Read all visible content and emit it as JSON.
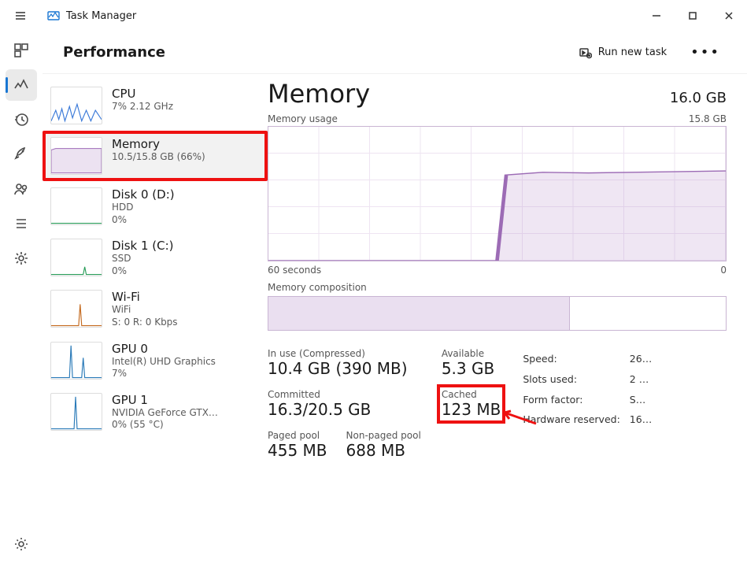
{
  "app": {
    "title": "Task Manager"
  },
  "header": {
    "page": "Performance",
    "run_new_task": "Run new task"
  },
  "rail": [
    {
      "name": "processes"
    },
    {
      "name": "performance",
      "active": true
    },
    {
      "name": "app-history"
    },
    {
      "name": "startup-apps"
    },
    {
      "name": "users"
    },
    {
      "name": "details"
    },
    {
      "name": "services"
    }
  ],
  "resources": [
    {
      "name": "CPU",
      "line1": "7%  2.12 GHz",
      "line2": ""
    },
    {
      "name": "Memory",
      "line1": "10.5/15.8 GB (66%)",
      "line2": "",
      "selected": true,
      "highlight": true
    },
    {
      "name": "Disk 0 (D:)",
      "line1": "HDD",
      "line2": "0%"
    },
    {
      "name": "Disk 1 (C:)",
      "line1": "SSD",
      "line2": "0%"
    },
    {
      "name": "Wi-Fi",
      "line1": "WiFi",
      "line2": "S: 0 R: 0 Kbps"
    },
    {
      "name": "GPU 0",
      "line1": "Intel(R) UHD Graphics",
      "line2": "7%"
    },
    {
      "name": "GPU 1",
      "line1": "NVIDIA GeForce GTX…",
      "line2": "0%  (55 °C)"
    }
  ],
  "detail": {
    "title": "Memory",
    "capacity": "16.0 GB",
    "usage_label": "Memory usage",
    "usage_cap": "15.8 GB",
    "axis_left": "60 seconds",
    "axis_right": "0",
    "composition_label": "Memory composition"
  },
  "stats": {
    "in_use_label": "In use (Compressed)",
    "in_use_value": "10.4 GB (390 MB)",
    "available_label": "Available",
    "available_value": "5.3 GB",
    "committed_label": "Committed",
    "committed_value": "16.3/20.5 GB",
    "cached_label": "Cached",
    "cached_value": "123 MB",
    "paged_label": "Paged pool",
    "paged_value": "455 MB",
    "nonpaged_label": "Non-paged pool",
    "nonpaged_value": "688 MB",
    "keys": {
      "speed": "Speed:",
      "speed_v": "26…",
      "slots": "Slots used:",
      "slots_v": "2 …",
      "form": "Form factor:",
      "form_v": "S…",
      "hw": "Hardware reserved:",
      "hw_v": "16…"
    }
  },
  "chart_data": {
    "type": "area",
    "title": "Memory usage",
    "ylabel": "GB",
    "ylim": [
      0,
      15.8
    ],
    "x_seconds": [
      60,
      54,
      48,
      42,
      36,
      30,
      27,
      24,
      18,
      12,
      6,
      0
    ],
    "values": [
      0,
      0,
      0,
      0,
      0,
      0,
      10.0,
      10.3,
      10.4,
      10.5,
      10.4,
      10.5
    ],
    "composition_pct": {
      "in_use": 66,
      "modified": 0,
      "standby": 0,
      "free": 34
    }
  }
}
